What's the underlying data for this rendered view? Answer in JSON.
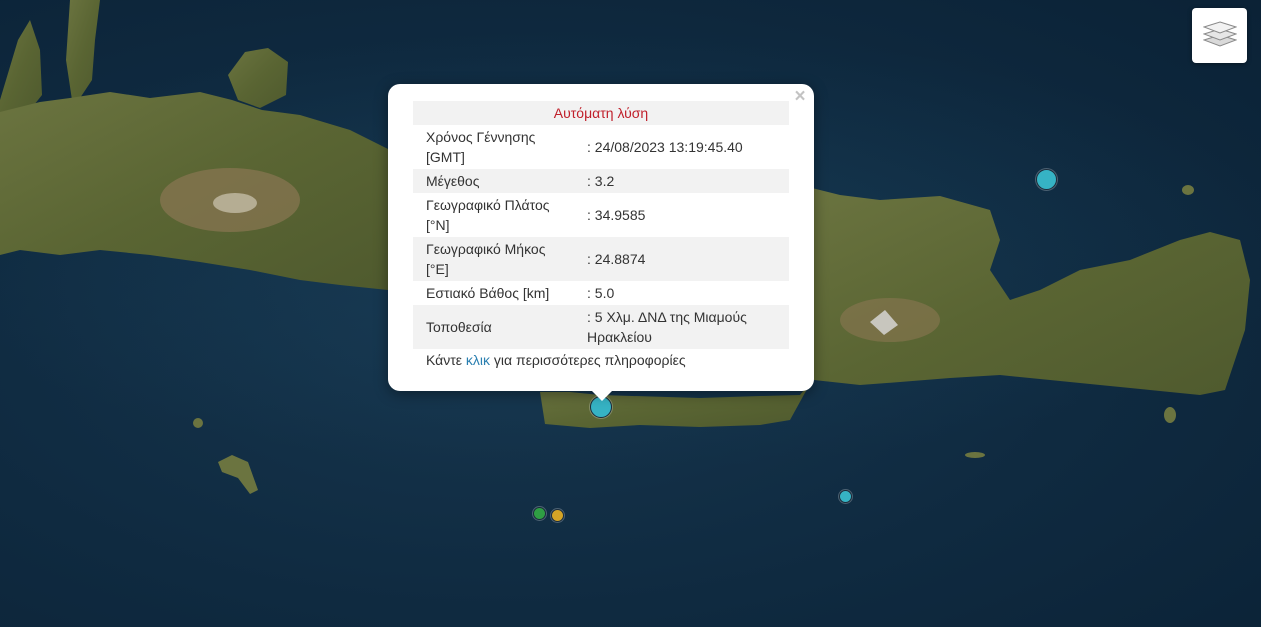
{
  "map": {
    "colors": {
      "sea": "#102b42",
      "land": "#5c6a36",
      "mountain": "#8a7652",
      "snow": "#dcdcdc"
    }
  },
  "markers": [
    {
      "name": "quake-marker-selected",
      "color": "#36b3c4"
    },
    {
      "name": "quake-marker-ne",
      "color": "#36b3c4"
    },
    {
      "name": "quake-marker-se",
      "color": "#36b3c4"
    },
    {
      "name": "quake-marker-green",
      "color": "#2f9e44"
    },
    {
      "name": "quake-marker-yellow",
      "color": "#d4a426"
    }
  ],
  "layers_control": {
    "icon": "layers-icon"
  },
  "popup": {
    "close_label": "×",
    "title": "Αυτόματη λύση",
    "rows": [
      {
        "label": "Χρόνος Γέννησης [GMT]",
        "value": ": 24/08/2023 13:19:45.40"
      },
      {
        "label": "Μέγεθος",
        "value": ": 3.2"
      },
      {
        "label": "Γεωγραφικό Πλάτος [°N]",
        "value": ": 34.9585"
      },
      {
        "label": "Γεωγραφικό Μήκος [°E]",
        "value": ": 24.8874"
      },
      {
        "label": "Εστιακό Βάθος [km]",
        "value": ": 5.0"
      },
      {
        "label": "Τοποθεσία",
        "value": ": 5 Χλμ. ΔΝΔ της Μιαμούς Ηρακλείου"
      }
    ],
    "more_prefix": "Κάντε ",
    "more_link": "κλικ",
    "more_suffix": " για περισσότερες πληροφορίες"
  }
}
